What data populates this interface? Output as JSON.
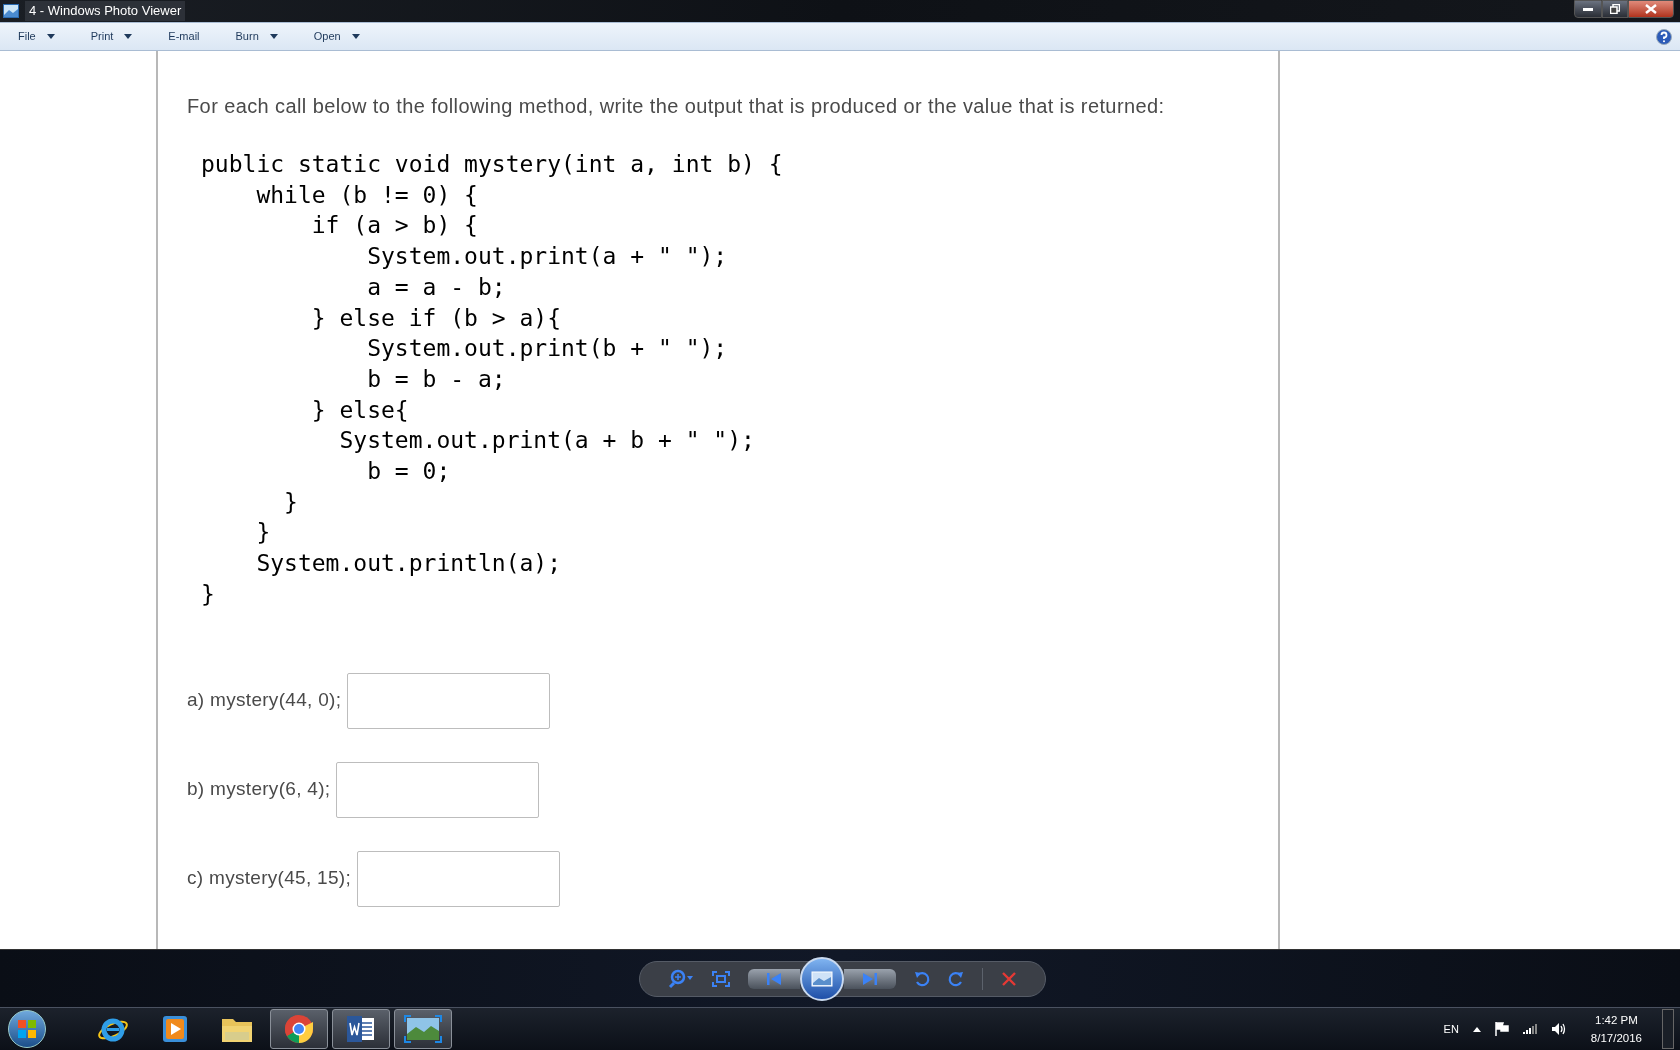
{
  "window": {
    "title": "4 - Windows Photo Viewer"
  },
  "menu": [
    {
      "label": "File",
      "dropdown": true
    },
    {
      "label": "Print",
      "dropdown": true
    },
    {
      "label": "E-mail",
      "dropdown": false
    },
    {
      "label": "Burn",
      "dropdown": true
    },
    {
      "label": "Open",
      "dropdown": true
    }
  ],
  "prompt": "For each call below to the following method, write the output that is produced or the value that is returned:",
  "code": [
    "public static void mystery(int a, int b) {",
    "    while (b != 0) {",
    "        if (a > b) {",
    "            System.out.print(a + \" \");",
    "            a = a - b;",
    "        } else if (b > a){",
    "            System.out.print(b + \" \");",
    "            b = b - a;",
    "        } else{",
    "          System.out.print(a + b + \" \");",
    "            b = 0;",
    "      }",
    "    }",
    "    System.out.println(a);",
    "}"
  ],
  "questions": [
    {
      "label": "a) mystery(44, 0);"
    },
    {
      "label": "b) mystery(6, 4);"
    },
    {
      "label": "c) mystery(45, 15);"
    }
  ],
  "taskbar": {
    "apps": [
      {
        "kind": "ie",
        "running": false
      },
      {
        "kind": "media",
        "running": false
      },
      {
        "kind": "folder",
        "running": false
      },
      {
        "kind": "chrome",
        "running": true
      },
      {
        "kind": "word",
        "running": true
      },
      {
        "kind": "photos",
        "running": true
      }
    ],
    "language": "EN",
    "time": "1:42 PM",
    "date": "8/17/2016"
  }
}
